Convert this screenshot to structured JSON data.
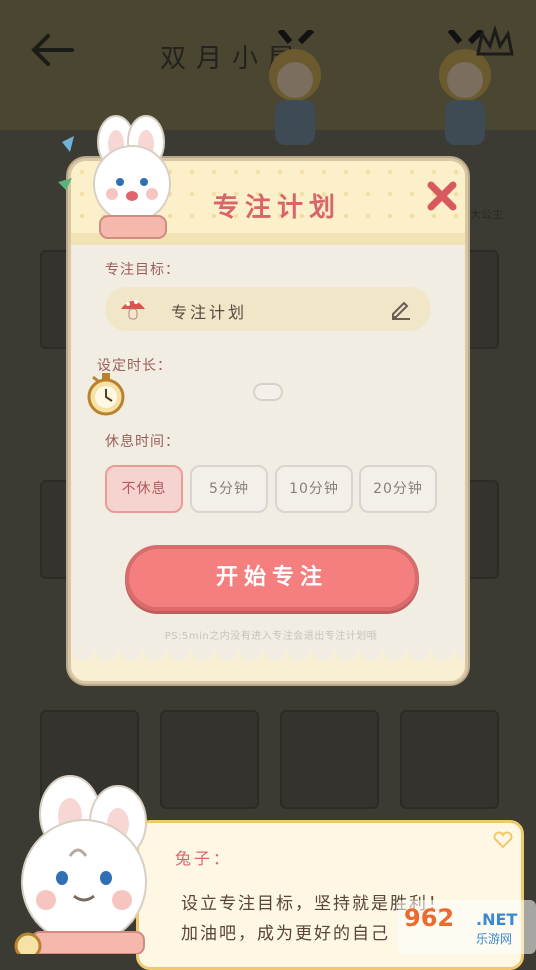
{
  "background": {
    "title": "双月小屋",
    "small_text": "大公主"
  },
  "modal": {
    "title": "专注计划",
    "goal_label": "专注目标：",
    "goal_value": "专注计划",
    "duration_label": "设定时长：",
    "rest_label": "休息时间：",
    "rest_options": [
      "不休息",
      "5分钟",
      "10分钟",
      "20分钟"
    ],
    "rest_selected": "不休息",
    "start_button": "开始专注",
    "note": "PS:5min之内没有进入专注会退出专注计划哦"
  },
  "dialog": {
    "speaker": "兔子：",
    "line1": "设立专注目标，坚持就是胜利！",
    "line2": "加油吧，成为更好的自己"
  },
  "watermark": {
    "logo": "962",
    "net": ".NET",
    "sub": "乐游网"
  },
  "colors": {
    "accent": "#f57f7f",
    "title_red": "#d9656a",
    "dialog_border": "#f2c96a"
  }
}
